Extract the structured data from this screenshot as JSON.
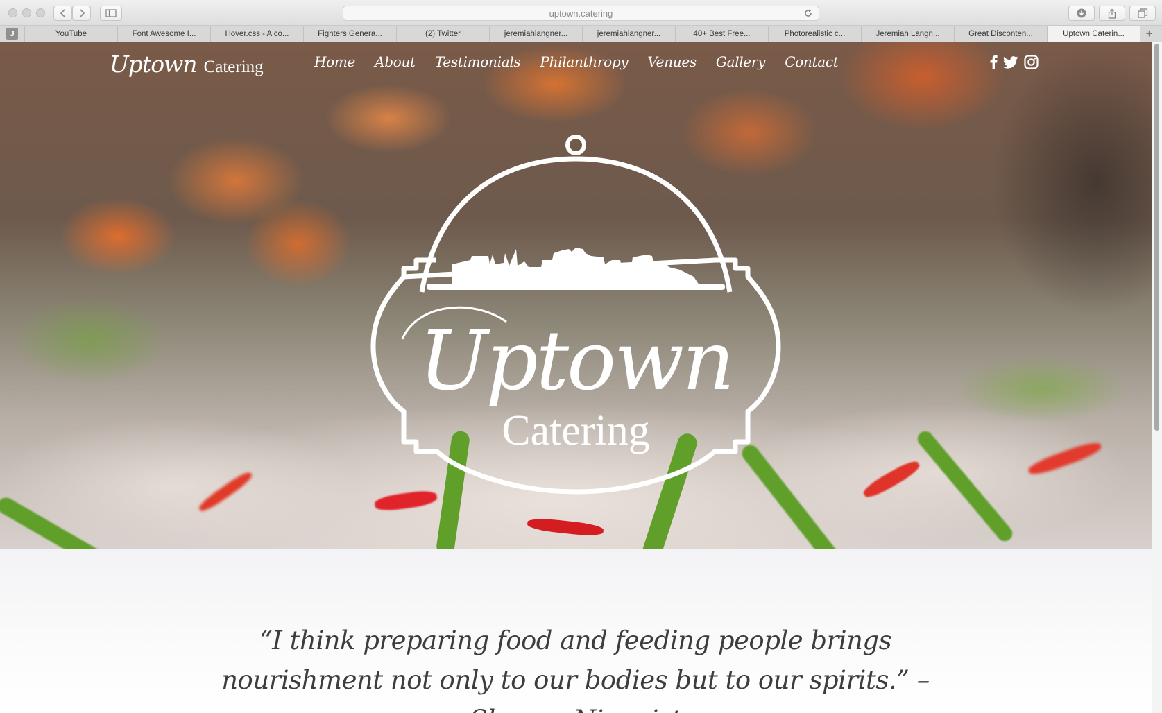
{
  "browser": {
    "url": "uptown.catering",
    "tabs": [
      {
        "label": "YouTube"
      },
      {
        "label": "Font Awesome I..."
      },
      {
        "label": "Hover.css - A co..."
      },
      {
        "label": "Fighters Genera..."
      },
      {
        "label": "(2) Twitter"
      },
      {
        "label": "jeremiahlangner..."
      },
      {
        "label": "jeremiahlangner..."
      },
      {
        "label": "40+ Best Free..."
      },
      {
        "label": "Photorealistic c..."
      },
      {
        "label": "Jeremiah Langn..."
      },
      {
        "label": "Great Disconten..."
      },
      {
        "label": "Uptown Caterin...",
        "active": true
      }
    ],
    "favicon_letter": "J"
  },
  "site": {
    "logo_script": "Uptown",
    "logo_plain": "Catering",
    "nav": {
      "home": "Home",
      "about": "About",
      "testimonials": "Testimonials",
      "philanthropy": "Philanthropy",
      "venues": "Venues",
      "gallery": "Gallery",
      "contact": "Contact"
    },
    "social_icons": [
      "facebook-icon",
      "twitter-icon",
      "instagram-icon"
    ],
    "emblem": {
      "script": "Uptown",
      "plain": "Catering"
    },
    "quote": "“I think preparing food and feeding people brings nourishment not only to our bodies but to our spirits.” – Shauna Niequist"
  }
}
